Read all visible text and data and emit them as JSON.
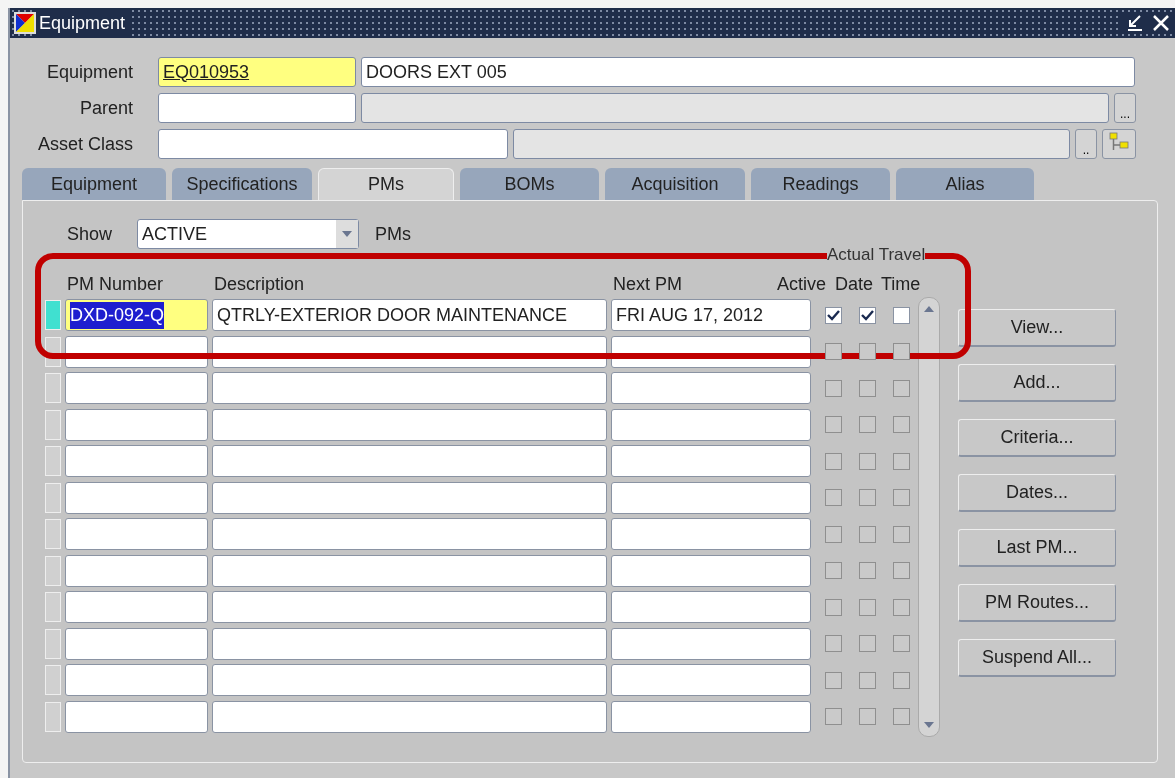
{
  "window": {
    "title": "Equipment"
  },
  "header": {
    "equipment_label": "Equipment",
    "equipment_code": "EQ010953",
    "equipment_description": "DOORS EXT 005",
    "parent_label": "Parent",
    "parent_lov_button": "...",
    "asset_class_label": "Asset Class",
    "asset_class_lov_button": ".."
  },
  "tabs": [
    {
      "label": "Equipment",
      "selected": false
    },
    {
      "label": "Specifications",
      "selected": false
    },
    {
      "label": "PMs",
      "selected": true
    },
    {
      "label": "BOMs",
      "selected": false
    },
    {
      "label": "Acquisition",
      "selected": false
    },
    {
      "label": "Readings",
      "selected": false
    },
    {
      "label": "Alias",
      "selected": false
    }
  ],
  "filter": {
    "label": "Show",
    "value": "ACTIVE",
    "suffix": "PMs"
  },
  "table": {
    "group_header": "Actual Travel",
    "columns": [
      "PM Number",
      "Description",
      "Next PM",
      "Active",
      "Date",
      "Time"
    ],
    "rows": [
      {
        "pm_number": "DXD-092-Q",
        "description": "QTRLY-EXTERIOR DOOR MAINTENANCE",
        "next_pm": "FRI AUG 17, 2012",
        "active": true,
        "actual_date": true,
        "travel_time": false,
        "selected": true,
        "disabled": false
      },
      {
        "active": false,
        "actual_date": false,
        "travel_time": false,
        "selected": false,
        "disabled": true
      },
      {
        "active": false,
        "actual_date": false,
        "travel_time": false,
        "selected": false,
        "disabled": true
      },
      {
        "active": false,
        "actual_date": false,
        "travel_time": false,
        "selected": false,
        "disabled": true
      },
      {
        "active": false,
        "actual_date": false,
        "travel_time": false,
        "selected": false,
        "disabled": true
      },
      {
        "active": false,
        "actual_date": false,
        "travel_time": false,
        "selected": false,
        "disabled": true
      },
      {
        "active": false,
        "actual_date": false,
        "travel_time": false,
        "selected": false,
        "disabled": true
      },
      {
        "active": false,
        "actual_date": false,
        "travel_time": false,
        "selected": false,
        "disabled": true
      },
      {
        "active": false,
        "actual_date": false,
        "travel_time": false,
        "selected": false,
        "disabled": true
      },
      {
        "active": false,
        "actual_date": false,
        "travel_time": false,
        "selected": false,
        "disabled": true
      },
      {
        "active": false,
        "actual_date": false,
        "travel_time": false,
        "selected": false,
        "disabled": true
      },
      {
        "active": false,
        "actual_date": false,
        "travel_time": false,
        "selected": false,
        "disabled": true
      }
    ]
  },
  "buttons": [
    "View...",
    "Add...",
    "Criteria...",
    "Dates...",
    "Last PM...",
    "PM Routes...",
    "Suspend All..."
  ]
}
